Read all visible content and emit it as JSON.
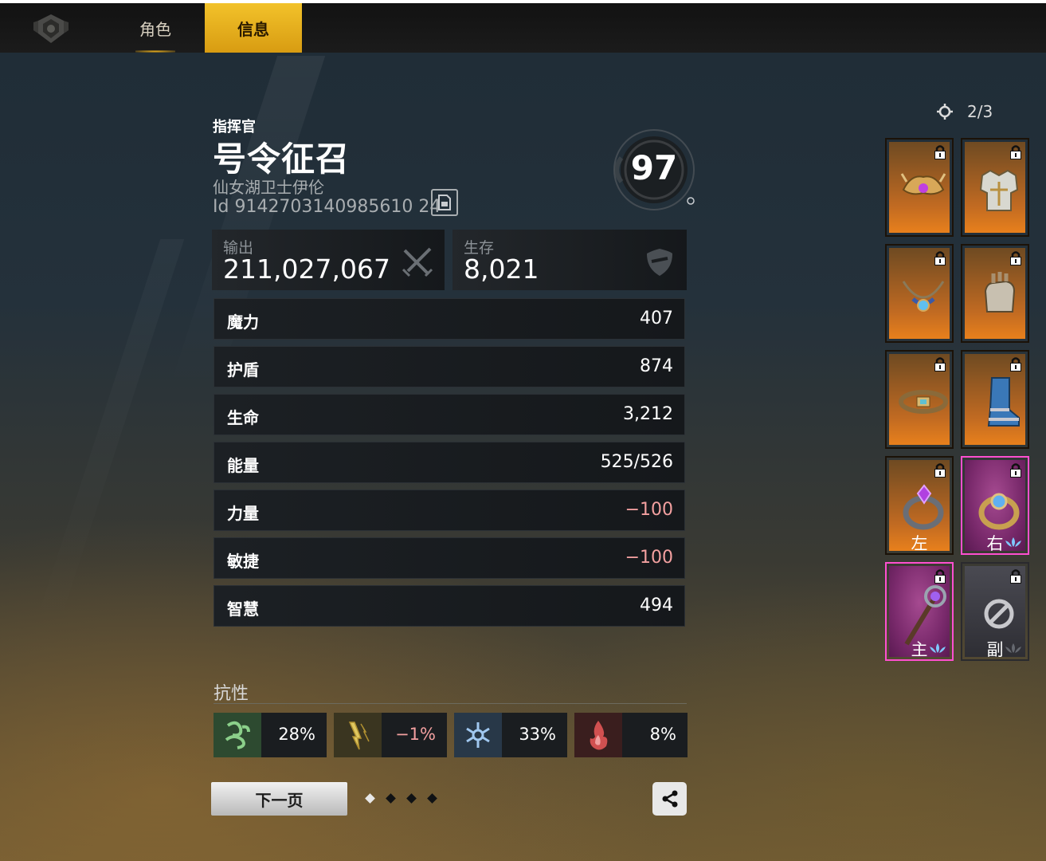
{
  "tabs": [
    {
      "label": "角色",
      "active": false
    },
    {
      "label": "信息",
      "active": true
    }
  ],
  "commander": {
    "role": "指挥官",
    "name": "号令征召",
    "subtitle": "仙女湖卫士伊伦",
    "id": "Id 9142703140985610 24",
    "level": "97"
  },
  "power": {
    "output": {
      "label": "输出",
      "value": "211,027,067"
    },
    "survival": {
      "label": "生存",
      "value": "8,021"
    }
  },
  "stats": [
    {
      "label": "魔力",
      "value": "407",
      "negative": false
    },
    {
      "label": "护盾",
      "value": "874",
      "negative": false
    },
    {
      "label": "生命",
      "value": "3,212",
      "negative": false
    },
    {
      "label": "能量",
      "value": "525/526",
      "negative": false
    },
    {
      "label": "力量",
      "value": "−100",
      "negative": true
    },
    {
      "label": "敏捷",
      "value": "−100",
      "negative": true
    },
    {
      "label": "智慧",
      "value": "494",
      "negative": false
    }
  ],
  "resistance": {
    "title": "抗性",
    "items": [
      {
        "icon": "wind-resist-icon",
        "value": "28%",
        "negative": false,
        "color": "#3a8a3a"
      },
      {
        "icon": "lightning-resist-icon",
        "value": "−1%",
        "negative": true,
        "color": "#8a7a2a"
      },
      {
        "icon": "frost-resist-icon",
        "value": "33%",
        "negative": false,
        "color": "#3a6a9a"
      },
      {
        "icon": "fire-resist-icon",
        "value": "8%",
        "negative": false,
        "color": "#9a3030"
      }
    ]
  },
  "footer": {
    "next_label": "下一页",
    "page_count": 4,
    "current_page": 1
  },
  "gear": {
    "preset": "2/3",
    "slots": [
      {
        "name": "helmet",
        "rarity": "orange",
        "locked": true,
        "side": ""
      },
      {
        "name": "armor",
        "rarity": "orange",
        "locked": true,
        "side": ""
      },
      {
        "name": "necklace",
        "rarity": "orange",
        "locked": true,
        "side": ""
      },
      {
        "name": "gloves",
        "rarity": "orange",
        "locked": true,
        "side": ""
      },
      {
        "name": "belt",
        "rarity": "orange",
        "locked": true,
        "side": ""
      },
      {
        "name": "boots",
        "rarity": "orange",
        "locked": true,
        "side": ""
      },
      {
        "name": "ring-left",
        "rarity": "orange",
        "locked": true,
        "side": "左"
      },
      {
        "name": "ring-right",
        "rarity": "pink",
        "locked": true,
        "side": "右"
      },
      {
        "name": "main-weapon",
        "rarity": "pink",
        "locked": true,
        "side": "主"
      },
      {
        "name": "off-hand",
        "rarity": "gray",
        "locked": true,
        "side": "副"
      }
    ]
  },
  "colors": {
    "accent_gold": "#f2c22a",
    "negative_text": "#f3a0a0",
    "rarity_orange": "#e8801c",
    "rarity_pink": "#ff4fd0"
  }
}
